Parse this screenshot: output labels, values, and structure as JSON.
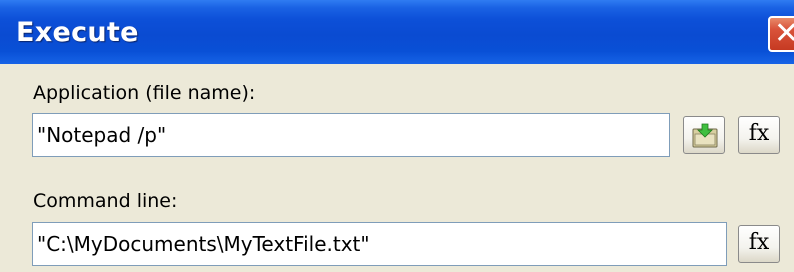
{
  "window": {
    "title": "Execute",
    "close_glyph": "✕"
  },
  "application": {
    "label": "Application (file name):",
    "value": "\"Notepad /p\"",
    "browse_icon": "open-folder-icon",
    "fx_label": "fx"
  },
  "command_line": {
    "label": "Command line:",
    "value": "\"C:\\MyDocuments\\MyTextFile.txt\"",
    "fx_label": "fx"
  },
  "colors": {
    "titlebar": "#0a4bd2",
    "close_button": "#d9533a",
    "dialog_background": "#ece9d8",
    "field_border": "#7f9db9"
  }
}
